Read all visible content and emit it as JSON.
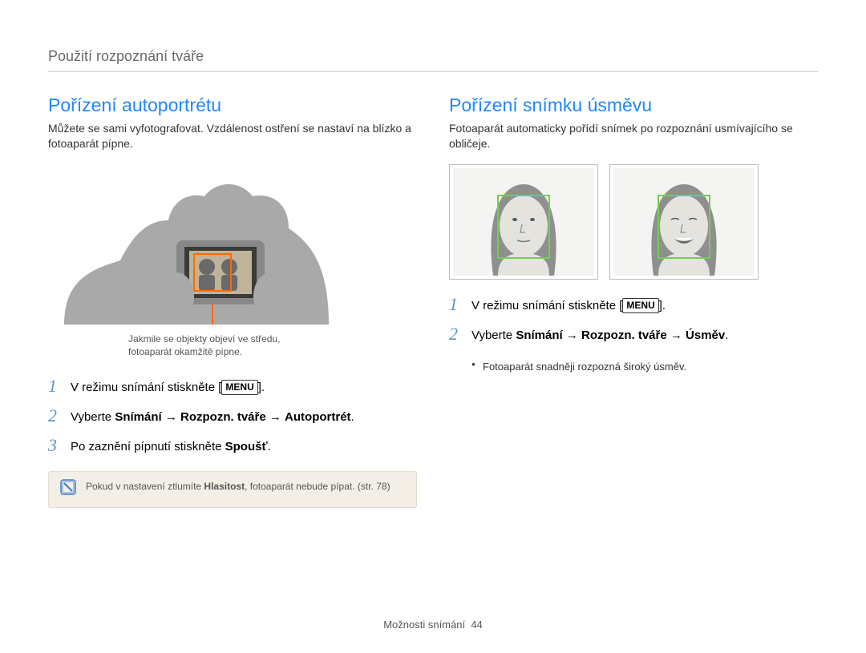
{
  "header": "Použití rozpoznání tváře",
  "left": {
    "title": "Pořízení autoportrétu",
    "intro": "Můžete se sami vyfotografovat. Vzdálenost ostření se nastaví na blízko a fotoaparát pípne.",
    "caption1": "Jakmile se objekty objeví ve středu,",
    "caption2": "fotoaparát okamžitě pípne.",
    "step1_pre": "V režimu snímání stiskněte [",
    "step1_menu": "MENU",
    "step1_post": "].",
    "step2_pre": "Vyberte ",
    "step2_b1": "Snímání",
    "step2_arrow1": " → ",
    "step2_b2": "Rozpozn. tváře",
    "step2_arrow2": " → ",
    "step2_b3": "Autoportrét",
    "step2_post": ".",
    "step3_pre": "Po zaznění pípnutí stiskněte ",
    "step3_b": "Spoušť",
    "step3_post": ".",
    "note_pre": "Pokud v nastavení ztlumíte ",
    "note_b": "Hlasitost",
    "note_post": ", fotoaparát nebude pípat. (str. 78)"
  },
  "right": {
    "title": "Pořízení snímku úsměvu",
    "intro": "Fotoaparát automaticky pořídí snímek po rozpoznání usmívajícího se obličeje.",
    "step1_pre": "V režimu snímání stiskněte [",
    "step1_menu": "MENU",
    "step1_post": "].",
    "step2_pre": "Vyberte ",
    "step2_b1": "Snímání",
    "step2_arrow1": " → ",
    "step2_b2": "Rozpozn. tváře",
    "step2_arrow2": " → ",
    "step2_b3": "Úsměv",
    "step2_post": ".",
    "bullet1": "Fotoaparát snadněji rozpozná široký úsměv."
  },
  "footer": {
    "label": "Možnosti snímání",
    "page": "44"
  }
}
